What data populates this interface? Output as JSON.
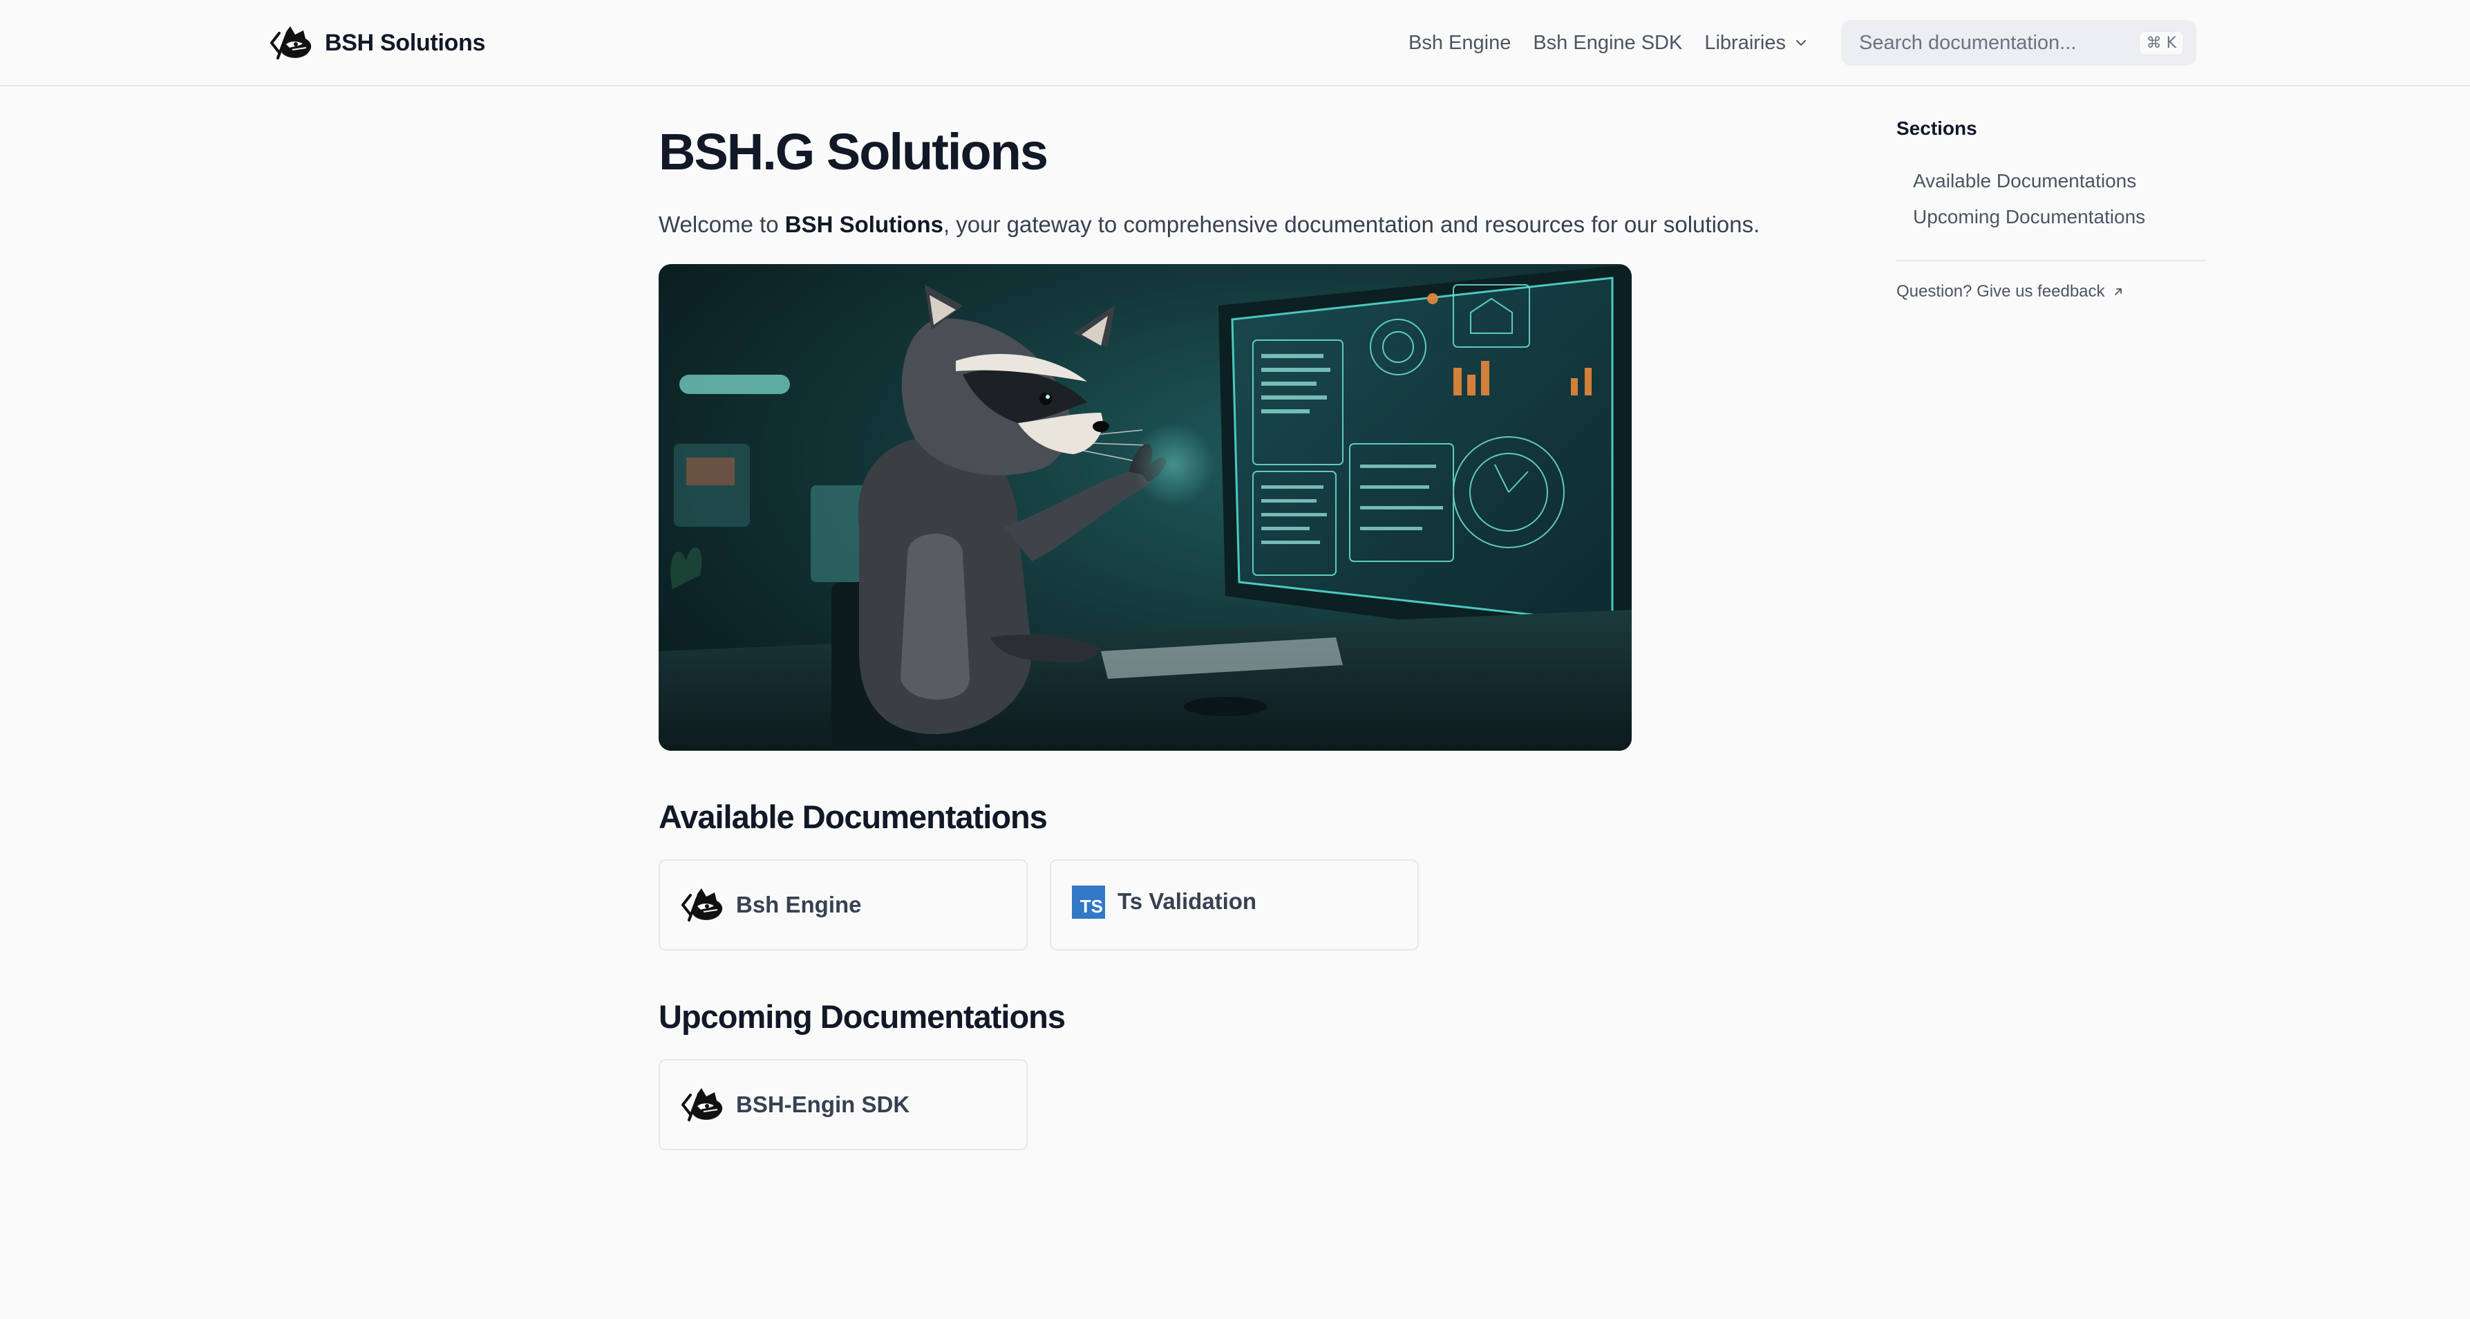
{
  "navbar": {
    "brand": "BSH Solutions",
    "links": [
      {
        "label": "Bsh Engine"
      },
      {
        "label": "Bsh Engine SDK"
      },
      {
        "label": "Librairies"
      }
    ],
    "search": {
      "placeholder": "Search documentation...",
      "shortcut": "⌘ K"
    }
  },
  "main": {
    "title": "BSH.G Solutions",
    "intro": {
      "prefix": "Welcome to ",
      "brand": "BSH Solutions",
      "suffix": ", your gateway to comprehensive documentation and resources for our solutions."
    },
    "available": {
      "title": "Available Documentations",
      "cards": [
        {
          "label": "Bsh Engine",
          "icon": "raccoon-logo-icon"
        },
        {
          "label": "Ts Validation",
          "icon": "typescript-icon",
          "icon_text": "TS"
        }
      ]
    },
    "upcoming": {
      "title": "Upcoming Documentations",
      "cards": [
        {
          "label": "BSH-Engin SDK",
          "icon": "raccoon-logo-icon"
        }
      ]
    }
  },
  "toc": {
    "title": "Sections",
    "items": [
      {
        "label": "Available Documentations"
      },
      {
        "label": "Upcoming Documentations"
      }
    ],
    "feedback": "Question? Give us feedback"
  },
  "colors": {
    "background": "#fafafa",
    "text": "#111827",
    "muted": "#4b5563",
    "border": "#e5e7eb",
    "typescript": "#3178c6"
  }
}
